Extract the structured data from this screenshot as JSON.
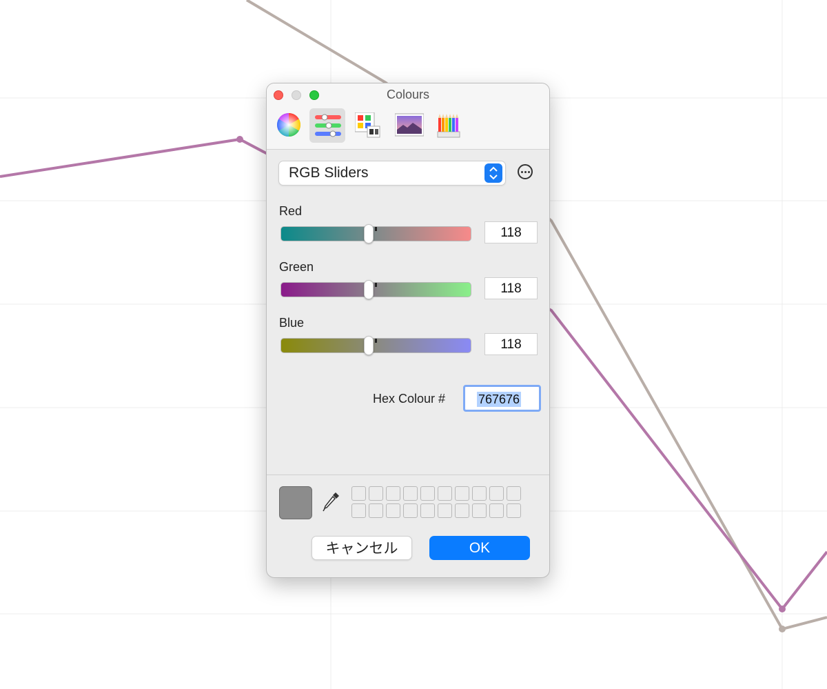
{
  "window": {
    "title": "Colours"
  },
  "toolbar": {
    "tools": [
      "colour-wheel",
      "colour-sliders",
      "colour-palettes",
      "image-palettes",
      "pencils"
    ],
    "active": "colour-sliders"
  },
  "mode_popup": {
    "selected": "RGB Sliders"
  },
  "sliders": {
    "red": {
      "label": "Red",
      "value": "118",
      "level": 0.4627,
      "from": "#0b8a8a",
      "to": "#f78a8a"
    },
    "green": {
      "label": "Green",
      "value": "118",
      "level": 0.4627,
      "from": "#8a1b8a",
      "to": "#8af08a"
    },
    "blue": {
      "label": "Blue",
      "value": "118",
      "level": 0.4627,
      "from": "#8a8a0b",
      "to": "#8a8af5"
    }
  },
  "hex": {
    "label": "Hex Colour #",
    "value": "767676"
  },
  "current_colour": "#8c8c8c",
  "buttons": {
    "cancel": "キャンセル",
    "ok": "OK"
  },
  "colors": {
    "accent": "#0a7cff",
    "series_purple": "#b477a8",
    "series_taupe": "#b9aea8"
  }
}
